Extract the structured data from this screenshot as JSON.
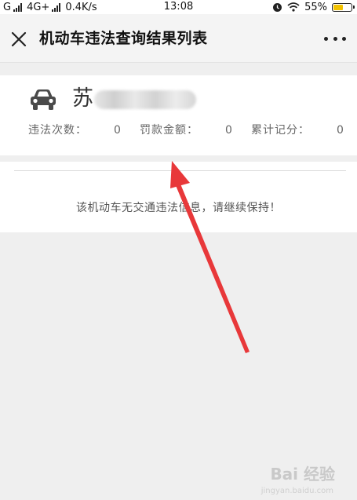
{
  "status_bar": {
    "carrier1": "G",
    "carrier2": "4G+",
    "speed": "0.4K/s",
    "time": "13:08",
    "battery": "55%",
    "battery_level": 0.55
  },
  "nav": {
    "title": "机动车违法查询结果列表"
  },
  "vehicle": {
    "plate_prefix": "苏",
    "stats": [
      {
        "label": "违法次数：",
        "value": "0"
      },
      {
        "label": "罚款金额：",
        "value": "0"
      },
      {
        "label": "累计记分：",
        "value": "0"
      }
    ]
  },
  "message": "该机动车无交通违法信息，请继续保持！",
  "watermark": {
    "text": "Bai 经验",
    "sub": "jingyan.baidu.com"
  },
  "colors": {
    "arrow": "#e8383a",
    "battery": "#f2c200"
  }
}
